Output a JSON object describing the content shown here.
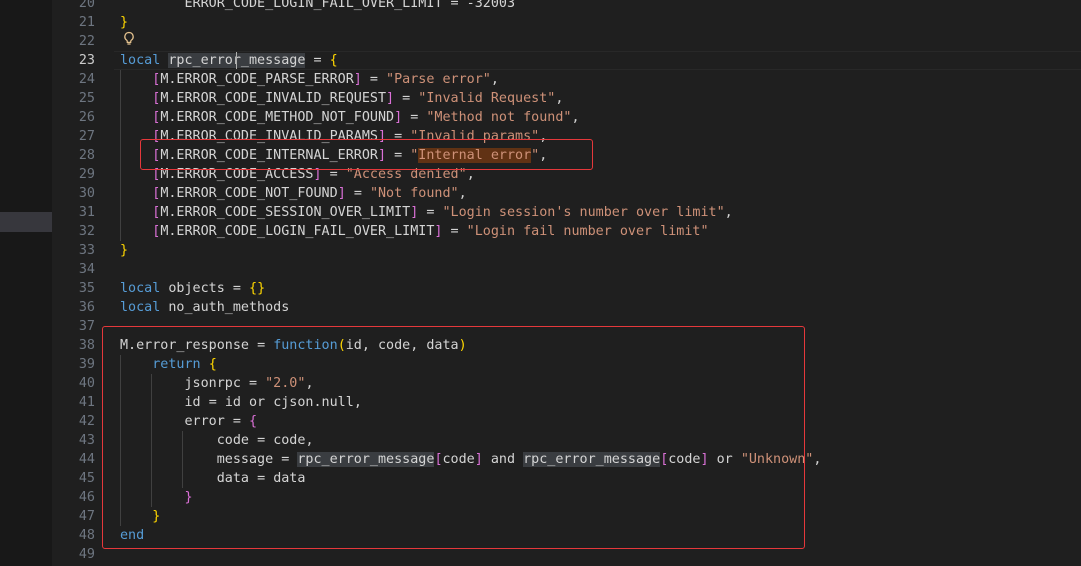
{
  "editor": {
    "lines": [
      {
        "num": "20",
        "text": "        ERROR_CODE_LOGIN_FAIL_OVER_LIMIT = -32003"
      },
      {
        "num": "21",
        "text": "}"
      },
      {
        "num": "22",
        "text": ""
      },
      {
        "num": "23",
        "text": "local rpc_error_message = {"
      },
      {
        "num": "24",
        "text": "    [M.ERROR_CODE_PARSE_ERROR] = \"Parse error\","
      },
      {
        "num": "25",
        "text": "    [M.ERROR_CODE_INVALID_REQUEST] = \"Invalid Request\","
      },
      {
        "num": "26",
        "text": "    [M.ERROR_CODE_METHOD_NOT_FOUND] = \"Method not found\","
      },
      {
        "num": "27",
        "text": "    [M.ERROR_CODE_INVALID_PARAMS] = \"Invalid params\","
      },
      {
        "num": "28",
        "text": "    [M.ERROR_CODE_INTERNAL_ERROR] = \"Internal error\","
      },
      {
        "num": "29",
        "text": "    [M.ERROR_CODE_ACCESS] = \"Access denied\","
      },
      {
        "num": "30",
        "text": "    [M.ERROR_CODE_NOT_FOUND] = \"Not found\","
      },
      {
        "num": "31",
        "text": "    [M.ERROR_CODE_SESSION_OVER_LIMIT] = \"Login session's number over limit\","
      },
      {
        "num": "32",
        "text": "    [M.ERROR_CODE_LOGIN_FAIL_OVER_LIMIT] = \"Login fail number over limit\""
      },
      {
        "num": "33",
        "text": "}"
      },
      {
        "num": "34",
        "text": ""
      },
      {
        "num": "35",
        "text": "local objects = {}"
      },
      {
        "num": "36",
        "text": "local no_auth_methods"
      },
      {
        "num": "37",
        "text": ""
      },
      {
        "num": "38",
        "text": "M.error_response = function(id, code, data)"
      },
      {
        "num": "39",
        "text": "    return {"
      },
      {
        "num": "40",
        "text": "        jsonrpc = \"2.0\","
      },
      {
        "num": "41",
        "text": "        id = id or cjson.null,"
      },
      {
        "num": "42",
        "text": "        error = {"
      },
      {
        "num": "43",
        "text": "            code = code,"
      },
      {
        "num": "44",
        "text": "            message = rpc_error_message[code] and rpc_error_message[code] or \"Unknown\","
      },
      {
        "num": "45",
        "text": "            data = data"
      },
      {
        "num": "46",
        "text": "        }"
      },
      {
        "num": "47",
        "text": "    }"
      },
      {
        "num": "48",
        "text": "end"
      },
      {
        "num": "49",
        "text": ""
      }
    ],
    "current_line": "23",
    "colors": {
      "background": "#1f1f1f",
      "keyword": "#569cd6",
      "string": "#ce9178",
      "bracket_gold": "#ffd700",
      "bracket_pink": "#da70d6",
      "annotation_box": "#e5383b"
    },
    "icons": [
      "lightbulb-icon"
    ]
  }
}
